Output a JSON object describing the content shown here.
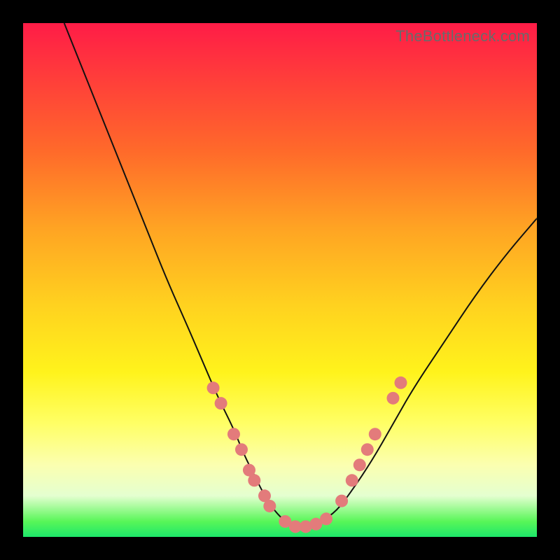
{
  "watermark": "TheBottleneck.com",
  "chart_data": {
    "type": "line",
    "title": "",
    "xlabel": "",
    "ylabel": "",
    "xlim": [
      0,
      100
    ],
    "ylim": [
      0,
      100
    ],
    "grid": false,
    "series": [
      {
        "name": "bottleneck-curve",
        "x": [
          8,
          12,
          16,
          20,
          24,
          28,
          32,
          35,
          38,
          41,
          43,
          45,
          47,
          49,
          51,
          53,
          55,
          58,
          61,
          64,
          68,
          72,
          76,
          82,
          88,
          94,
          100
        ],
        "y": [
          100,
          90,
          80,
          70,
          60,
          50,
          41,
          34,
          27,
          21,
          16,
          12,
          8,
          5,
          3,
          2,
          2,
          3,
          5,
          9,
          15,
          22,
          29,
          38,
          47,
          55,
          62
        ]
      }
    ],
    "markers": {
      "name": "highlight-points",
      "color": "#e37b7b",
      "points": [
        {
          "x": 37,
          "y": 29
        },
        {
          "x": 38.5,
          "y": 26
        },
        {
          "x": 41,
          "y": 20
        },
        {
          "x": 42.5,
          "y": 17
        },
        {
          "x": 44,
          "y": 13
        },
        {
          "x": 45,
          "y": 11
        },
        {
          "x": 47,
          "y": 8
        },
        {
          "x": 48,
          "y": 6
        },
        {
          "x": 51,
          "y": 3
        },
        {
          "x": 53,
          "y": 2
        },
        {
          "x": 55,
          "y": 2
        },
        {
          "x": 57,
          "y": 2.5
        },
        {
          "x": 59,
          "y": 3.5
        },
        {
          "x": 62,
          "y": 7
        },
        {
          "x": 64,
          "y": 11
        },
        {
          "x": 65.5,
          "y": 14
        },
        {
          "x": 67,
          "y": 17
        },
        {
          "x": 68.5,
          "y": 20
        },
        {
          "x": 72,
          "y": 27
        },
        {
          "x": 73.5,
          "y": 30
        }
      ]
    }
  }
}
